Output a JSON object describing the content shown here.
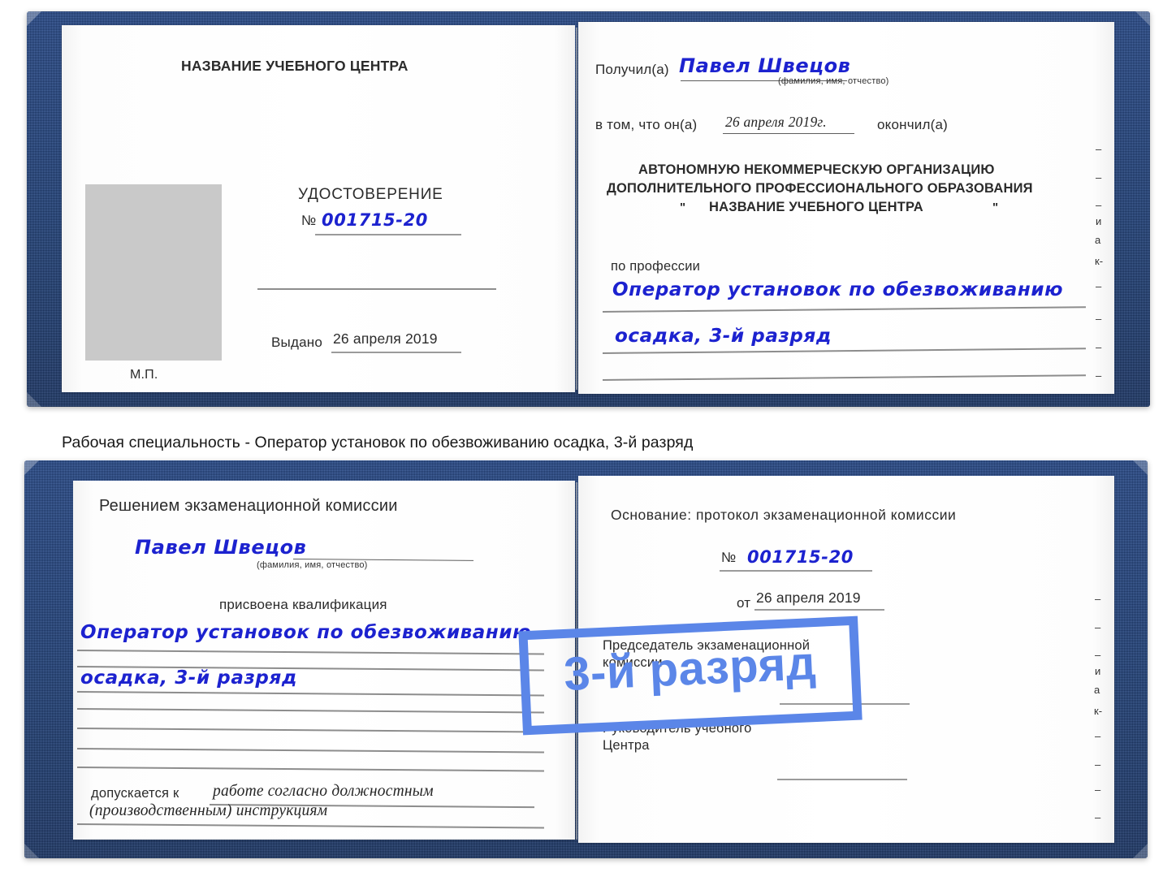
{
  "caption": "Рабочая специальность - Оператор установок по обезвоживанию осадка, 3-й разряд",
  "colors": {
    "cover_blue": "#264b8c",
    "ink_blue": "#1c22cf",
    "badge_blue": "#5b86e8",
    "paper_white": "#fefefe",
    "photo_gray": "#c9c9c9",
    "rule_gray": "#9b9b9b"
  },
  "badge": {
    "label": "3-й разряд"
  },
  "certificate_top": {
    "left_page": {
      "center_name": "НАЗВАНИЕ УЧЕБНОГО ЦЕНТРА",
      "doc_title": "УДОСТОВЕРЕНИЕ",
      "number_symbol": "№",
      "number_value": "001715-20",
      "issued_label": "Выдано",
      "issued_date": "26 апреля 2019",
      "stamp_label": "М.П."
    },
    "right_page": {
      "recipient_label": "Получил(а)",
      "recipient_name": "Павел Швецов",
      "fio_hint": "(фамилия, имя, отчество)",
      "that_he_label": "в том, что он(а)",
      "completion_date": "26 апреля 2019г.",
      "graduated_label": "окончил(а)",
      "org_line1": "АВТОНОМНУЮ НЕКОММЕРЧЕСКУЮ ОРГАНИЗАЦИЮ",
      "org_line2": "ДОПОЛНИТЕЛЬНОГО ПРОФЕССИОНАЛЬНОГО ОБРАЗОВАНИЯ",
      "org_quote_open": "\"",
      "org_name": "НАЗВАНИЕ УЧЕБНОГО ЦЕНТРА",
      "org_quote_close": "\"",
      "profession_label": "по профессии",
      "profession_line1": "Оператор установок по обезвоживанию",
      "profession_line2": "осадка, 3-й разряд",
      "edge_fragments": [
        "–",
        "–",
        "–",
        "и",
        "а",
        "к-",
        "–",
        "–",
        "–",
        "–"
      ]
    }
  },
  "certificate_bottom": {
    "left_page": {
      "heading": "Решением экзаменационной комиссии",
      "name": "Павел Швецов",
      "fio_hint": "(фамилия, имя, отчество)",
      "qualification_label": "присвоена квалификация",
      "qualification_line1": "Оператор установок по обезвоживанию",
      "qualification_line2": "осадка, 3-й разряд",
      "admitted_label": "допускается к",
      "admitted_line1": "работе согласно должностным",
      "admitted_line2": "(производственным) инструкциям"
    },
    "right_page": {
      "basis_label": "Основание: протокол экзаменационной комиссии",
      "number_symbol": "№",
      "number_value": "001715-20",
      "from_label": "от",
      "from_date": "26 апреля 2019",
      "chairman_line1": "Председатель экзаменационной",
      "chairman_line2": "комиссии",
      "head_line1": "Руководитель учебного",
      "head_line2": "Центра",
      "edge_fragments": [
        "–",
        "–",
        "–",
        "и",
        "а",
        "к-",
        "–",
        "–",
        "–",
        "–"
      ]
    }
  }
}
